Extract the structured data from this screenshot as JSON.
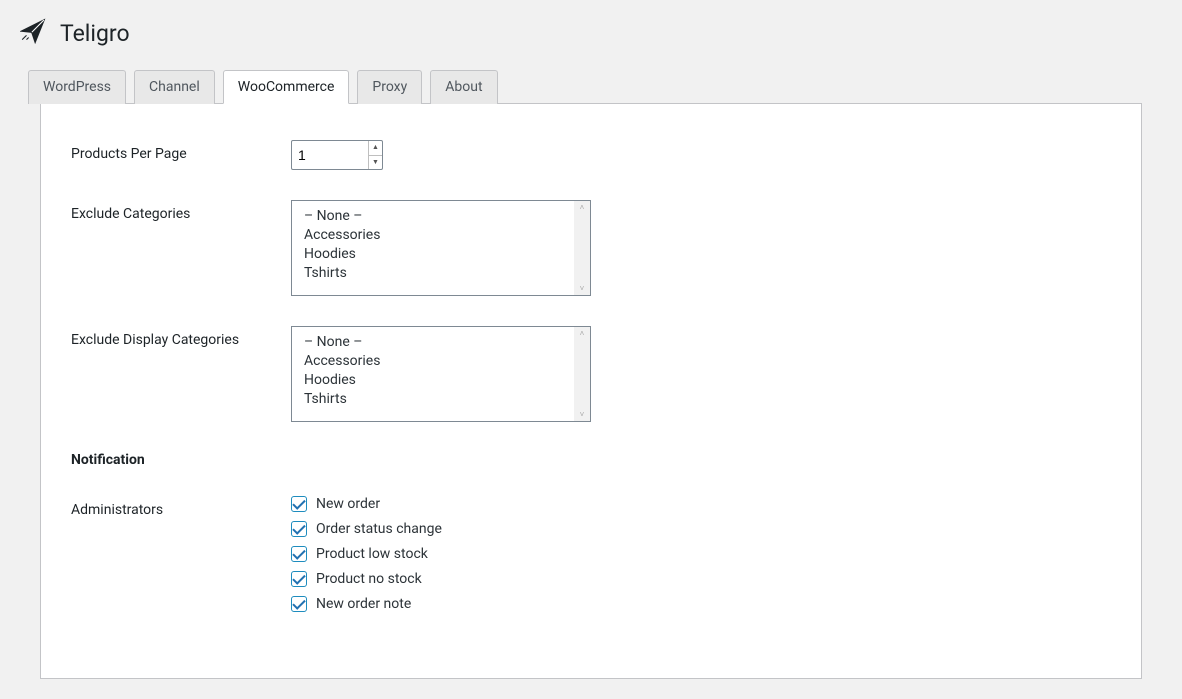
{
  "header": {
    "title": "Teligro"
  },
  "tabs": [
    {
      "label": "WordPress",
      "active": false
    },
    {
      "label": "Channel",
      "active": false
    },
    {
      "label": "WooCommerce",
      "active": true
    },
    {
      "label": "Proxy",
      "active": false
    },
    {
      "label": "About",
      "active": false
    }
  ],
  "fields": {
    "products_per_page": {
      "label": "Products Per Page",
      "value": "1"
    },
    "exclude_categories": {
      "label": "Exclude Categories",
      "options": [
        "– None –",
        "Accessories",
        "Hoodies",
        "Tshirts"
      ]
    },
    "exclude_display_categories": {
      "label": "Exclude Display Categories",
      "options": [
        "– None –",
        "Accessories",
        "Hoodies",
        "Tshirts"
      ]
    }
  },
  "notification": {
    "heading": "Notification",
    "administrators": {
      "label": "Administrators",
      "items": [
        {
          "label": "New order",
          "checked": true
        },
        {
          "label": "Order status change",
          "checked": true
        },
        {
          "label": "Product low stock",
          "checked": true
        },
        {
          "label": "Product no stock",
          "checked": true
        },
        {
          "label": "New order note",
          "checked": true
        }
      ]
    }
  }
}
